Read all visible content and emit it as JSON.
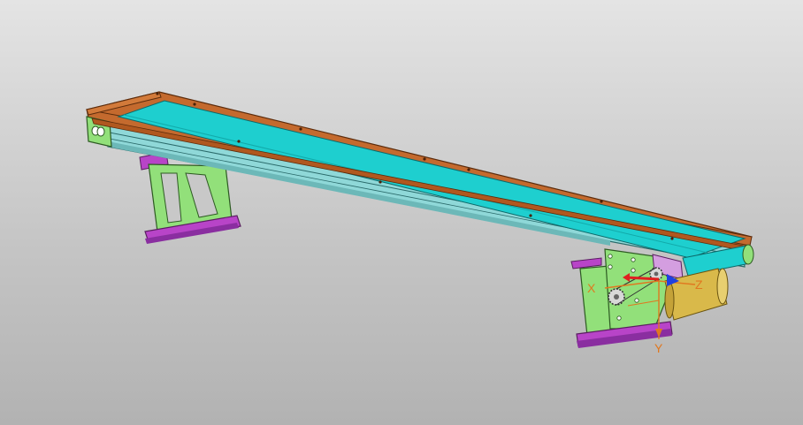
{
  "viewport": {
    "background_top": "#e4e4e4",
    "background_bottom": "#b2b2b2"
  },
  "colors": {
    "frame": "#c46a2e",
    "belt": "#1ecfcf",
    "rail": "#8fd8d8",
    "leg": "#92e07a",
    "foot": "#b844c8",
    "motor": "#d9b94a",
    "axis_orange": "#e07820",
    "axis_red": "#e02020",
    "axis_blue": "#2040e0"
  },
  "triad": {
    "x_label": "X",
    "y_label": "Y",
    "z_label": "Z",
    "icon": "coordinate-triad-icon"
  },
  "model": {
    "parts": [
      "conveyor-frame",
      "conveyor-belt",
      "side-rail",
      "left-leg-support",
      "right-leg-support",
      "drive-motor",
      "drive-sprocket"
    ]
  }
}
